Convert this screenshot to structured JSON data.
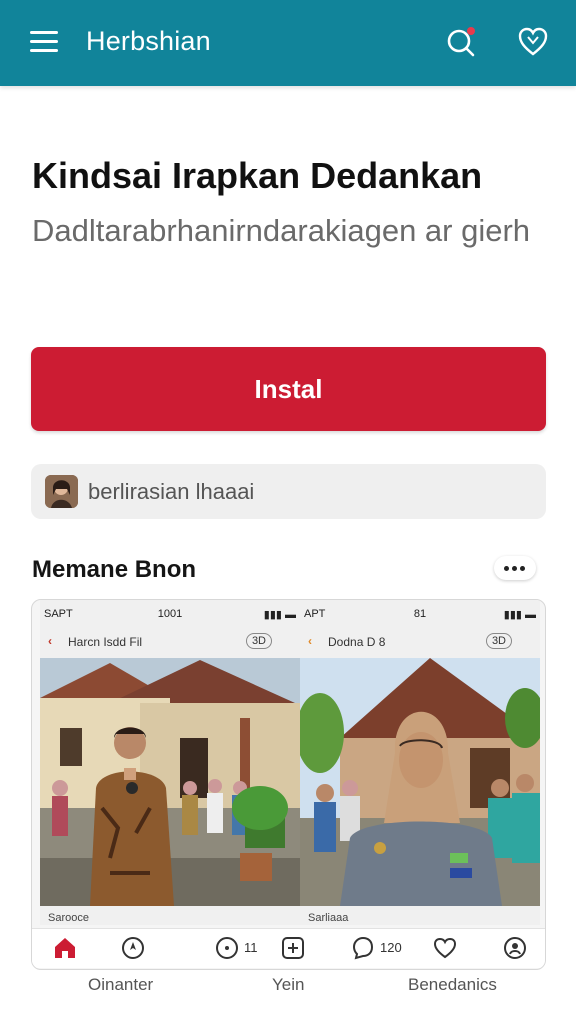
{
  "app_bar": {
    "title": "Herbshian",
    "background": "#11849a",
    "icons": [
      "menu-icon",
      "chat-search-icon",
      "heart-icon"
    ]
  },
  "headline": "Kindsai Irapkan Dedankan",
  "subtitle": "Dadltarabrhanirndarakiagen ar gierh",
  "install_button": {
    "label": "Instal",
    "color": "#cc1c33"
  },
  "source_chip": {
    "label": "berlirasian lhaaai"
  },
  "section": {
    "title": "Memane Bnon"
  },
  "screenshots": [
    {
      "carrier": "SAPT",
      "clock": "1001",
      "header_text": "Harcn Isdd Fil",
      "badge": "3D",
      "caption": "Sarooce"
    },
    {
      "carrier": "APT",
      "clock": "81",
      "header_text": "Dodna D 8",
      "badge": "3D",
      "caption": "Sarliaaa"
    }
  ],
  "gallery_tabbar": {
    "counts": {
      "comments": "11",
      "messages": "120"
    }
  },
  "bottom_labels": [
    "Oinanter",
    "Yein",
    "Benedanics"
  ]
}
